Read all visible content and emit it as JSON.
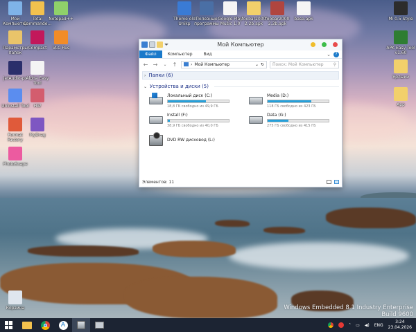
{
  "desktop_icons": [
    {
      "label": "Мой Компьютер",
      "icon": "computer-icon",
      "color": "#7fb3e8"
    },
    {
      "label": "Total Commande...",
      "icon": "total-commander-icon",
      "color": "#f2c14e"
    },
    {
      "label": "Notepad++",
      "icon": "notepad-plus-icon",
      "color": "#8fd16a"
    },
    {
      "label": "Параметры папок",
      "icon": "folder-options-icon",
      "color": "#e9c46a"
    },
    {
      "label": "Compact",
      "icon": "compact-icon",
      "color": "#c2185b"
    },
    {
      "label": "VLC Rus",
      "icon": "vlc-icon",
      "color": "#f28c28"
    },
    {
      "label": "jetAudio-px",
      "icon": "jetaudio-icon",
      "color": "#2b2f6b"
    },
    {
      "label": "Alpha Easy Tool",
      "icon": "alpha-easy-tool-icon",
      "color": "#f4f4f4"
    },
    {
      "label": "Uninstall Tool",
      "icon": "uninstall-tool-icon",
      "color": "#5b8def"
    },
    {
      "label": "HW",
      "icon": "hw-icon",
      "color": "#d35d6e"
    },
    {
      "label": "Format Factory",
      "icon": "format-factory-icon",
      "color": "#e05a3a"
    },
    {
      "label": "MyDrag",
      "icon": "mydrag-icon",
      "color": "#7e57c2"
    },
    {
      "label": "PhotoScape",
      "icon": "photoscape-icon",
      "color": "#ec5ba0"
    },
    {
      "label": "Theme old Unikp",
      "icon": "theme-icon",
      "color": "#3a7bd5"
    },
    {
      "label": "Полезные программы",
      "icon": "useful-programs-icon",
      "color": "#4a6fa5"
    },
    {
      "label": "Google Play Music 1.0",
      "icon": "document-icon",
      "color": "#f5f5f5"
    },
    {
      "label": "foobar2000 2.2b.apk",
      "icon": "folder-icon",
      "color": "#f2d06b"
    },
    {
      "label": "foobar2000 2.2b.apk",
      "icon": "archive-icon",
      "color": "#b0453f"
    },
    {
      "label": "base.apk",
      "icon": "document-icon",
      "color": "#f5f5f5"
    },
    {
      "label": "Mi 0.5 Style",
      "icon": "theme-icon",
      "color": "#2c2c2c"
    },
    {
      "label": "APK Easy Tool v1.60",
      "icon": "apk-easy-tool-icon",
      "color": "#2e7d32"
    },
    {
      "label": "Ярлыки",
      "icon": "shortcuts-folder-icon",
      "color": "#f2d06b"
    },
    {
      "label": "App",
      "icon": "app-folder-icon",
      "color": "#f2d06b"
    },
    {
      "label": "Корзина",
      "icon": "recycle-bin-icon",
      "color": "#dfe6ee"
    }
  ],
  "window": {
    "title": "Мой Компьютер",
    "ribbon_tabs": [
      "Файл",
      "Компьютер",
      "Вид"
    ],
    "address": "Мой Компьютер",
    "search_placeholder": "Поиск: Мой Компьютер",
    "groups": {
      "folders": "Папки (6)",
      "devices": "Устройства и диски (5)"
    },
    "drives": [
      {
        "name": "Локальный диск (C:)",
        "free_text": "18,8 ГБ свободно из 49,9 ГБ",
        "used_fraction": 0.62,
        "type": "system"
      },
      {
        "name": "Media (D:)",
        "free_text": "118 ГБ свободно из 423 ГБ",
        "used_fraction": 0.72,
        "type": "hdd"
      },
      {
        "name": "Install (F:)",
        "free_text": "38,9 ГБ свободно из 40,0 ГБ",
        "used_fraction": 0.03,
        "type": "hdd"
      },
      {
        "name": "Data (G:)",
        "free_text": "275 ГБ свободно из 415 ГБ",
        "used_fraction": 0.34,
        "type": "hdd"
      },
      {
        "name": "DVD RW дисковод (L:)",
        "type": "dvd"
      }
    ],
    "status": "Элементов: 11"
  },
  "watermark": {
    "line1": "Windows Embedded 8.1 Industry Enterprise",
    "line2": "Build 9600"
  },
  "taskbar": {
    "apps": [
      "windows-start-icon",
      "file-explorer-icon",
      "chrome-icon",
      "app-store-icon",
      "computer-icon",
      "vm-icon"
    ],
    "language": "ENG",
    "time": "3:24",
    "date": "23.04.2026"
  },
  "colors": {
    "accent": "#1979ca",
    "drive_bar": "#26a0da",
    "taskbar": "#1c2433"
  }
}
